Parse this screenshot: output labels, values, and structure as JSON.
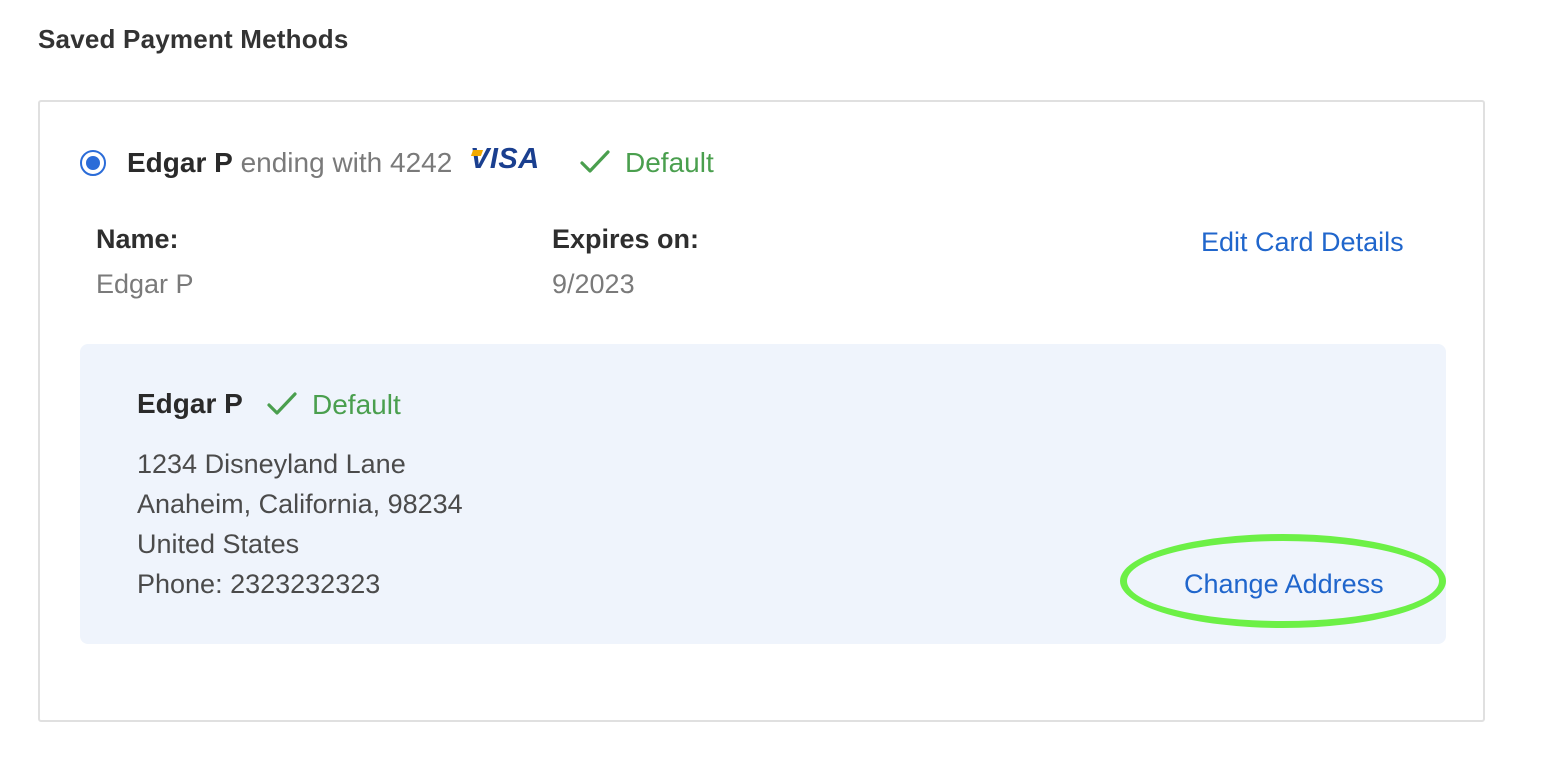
{
  "page": {
    "heading": "Saved Payment Methods"
  },
  "card": {
    "holder_name": "Edgar P",
    "ending_text": "ending with 4242",
    "brand": "VISA",
    "default_label": "Default",
    "name_label": "Name:",
    "name_value": "Edgar P",
    "expires_label": "Expires on:",
    "expires_value": "9/2023",
    "edit_link": "Edit Card Details",
    "selected": true
  },
  "billing_address": {
    "name": "Edgar P",
    "default_label": "Default",
    "street": "1234 Disneyland Lane",
    "city_line": "Anaheim, California, 98234",
    "country": "United States",
    "phone": "Phone: 2323232323",
    "change_link": "Change Address"
  },
  "colors": {
    "accent_blue": "#2066cc",
    "radio_blue": "#2b6cd8",
    "default_green": "#4a9f4e",
    "visa_blue": "#1a3f8f",
    "address_bg": "#eff4fc",
    "highlight_green": "#6cf046"
  },
  "icons": {
    "default_check": "check-icon",
    "radio": "radio-selected-icon"
  }
}
